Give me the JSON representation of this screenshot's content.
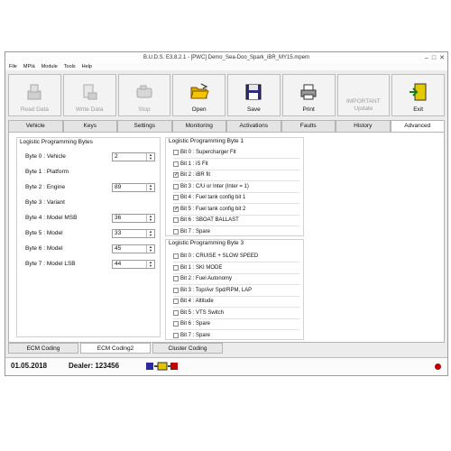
{
  "window": {
    "title": "B.U.D.S. E3.8.2.1 - [PWC] Demo_Sea-Doo_Spark_iBR_MY15.mpem"
  },
  "menu": [
    "File",
    "MPIá",
    "Module",
    "Tools",
    "Help"
  ],
  "toolbar": [
    {
      "label": "Read Data",
      "enabled": false,
      "icon": "read-data-icon"
    },
    {
      "label": "Write Data",
      "enabled": false,
      "icon": "write-data-icon"
    },
    {
      "label": "Stop",
      "enabled": false,
      "icon": "stop-engine-icon"
    },
    {
      "label": "Open",
      "enabled": true,
      "icon": "folder-open-icon"
    },
    {
      "label": "Save",
      "enabled": true,
      "icon": "floppy-disk-icon"
    },
    {
      "label": "Print",
      "enabled": true,
      "icon": "printer-icon"
    },
    {
      "label_line1": "IMPORTANT",
      "label_line2": "Update",
      "enabled": false
    },
    {
      "label": "Exit",
      "enabled": true,
      "icon": "exit-door-icon"
    }
  ],
  "tabs": [
    "Vehicle",
    "Keys",
    "Settings",
    "Monitoring",
    "Activations",
    "Faults",
    "History",
    "Advanced"
  ],
  "active_tab": "Advanced",
  "lpb": {
    "title": "Logistic Programming Bytes",
    "rows": [
      {
        "label": "Byte 0 : Vehicle",
        "value": "2"
      },
      {
        "label": "Byte 1 : Platform"
      },
      {
        "label": "Byte 2 : Engine",
        "value": "89"
      },
      {
        "label": "Byte 3 : Variant"
      },
      {
        "label": "Byte 4 : Model MSB",
        "value": "36"
      },
      {
        "label": "Byte 5 : Model",
        "value": "33"
      },
      {
        "label": "Byte 6 : Model",
        "value": "45"
      },
      {
        "label": "Byte 7 : Model LSB",
        "value": "44"
      }
    ]
  },
  "byte1": {
    "title": "Logistic Programming Byte 1",
    "bits": [
      {
        "label": "Bit 0 : Supercharger Fit",
        "checked": false
      },
      {
        "label": "Bit 1 : iS Fit",
        "checked": false
      },
      {
        "label": "Bit 2 : iBR fit",
        "checked": true
      },
      {
        "label": "Bit 3 : C/U or Inter (Inter = 1)",
        "checked": false
      },
      {
        "label": "Bit 4 : Fuel tank config bit 1",
        "checked": false
      },
      {
        "label": "Bit 5 : Fuel tank config bit 2",
        "checked": true
      },
      {
        "label": "Bit 6 : SBOAT BALLAST",
        "checked": false
      },
      {
        "label": "Bit 7 : Spare",
        "checked": false
      }
    ]
  },
  "byte3": {
    "title": "Logistic Programming Byte 3",
    "bits": [
      {
        "label": "Bit 0 : CRUISE + SLOW SPEED",
        "checked": false
      },
      {
        "label": "Bit 1 : SKI MODE",
        "checked": false
      },
      {
        "label": "Bit 2 : Fuel Autonomy",
        "checked": false
      },
      {
        "label": "Bit 3 : Top/Avr Spd/RPM, LAP",
        "checked": false
      },
      {
        "label": "Bit 4 : Altitude",
        "checked": false
      },
      {
        "label": "Bit 5 : VTS Switch",
        "checked": false
      },
      {
        "label": "Bit 6 : Spare",
        "checked": false
      },
      {
        "label": "Bit 7 : Spare",
        "checked": false
      }
    ]
  },
  "bottom_tabs": [
    "ECM Coding",
    "ECM Coding2",
    "Cluster Coding"
  ],
  "active_bottom_tab": "ECM Coding2",
  "status": {
    "date": "01.05.2018",
    "dealer": "Dealer: 123456",
    "indicator_color": "#b40000"
  }
}
